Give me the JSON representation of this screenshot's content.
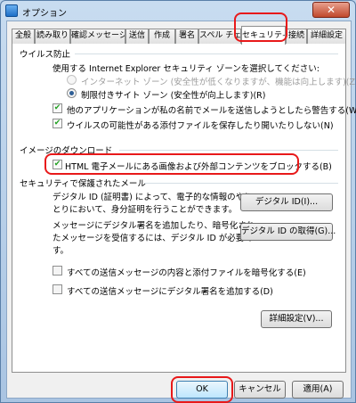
{
  "window": {
    "title": "オプション",
    "close": "✕"
  },
  "tabs": [
    {
      "label": "全般"
    },
    {
      "label": "読み取り"
    },
    {
      "label": "確認メッセージ"
    },
    {
      "label": "送信"
    },
    {
      "label": "作成"
    },
    {
      "label": "署名"
    },
    {
      "label": "スペル チェック"
    },
    {
      "label": "セキュリティ"
    },
    {
      "label": "接続"
    },
    {
      "label": "詳細設定"
    }
  ],
  "virus": {
    "group_label": "ウイルス防止",
    "zone_prompt": "使用する Internet Explorer セキュリティ ゾーンを選択してください:",
    "zone_internet": "インターネット ゾーン (安全性が低くなりますが、機能は向上します)(Z)",
    "zone_restricted": "制限付きサイト ゾーン (安全性が向上します)(R)",
    "warn_send": "他のアプリケーションが私の名前でメールを送信しようとしたら警告する(W)",
    "block_attach": "ウイルスの可能性がある添付ファイルを保存したり開いたりしない(N)"
  },
  "image": {
    "group_label": "イメージのダウンロード",
    "block_external": "HTML 電子メールにある画像および外部コンテンツをブロックする(B)"
  },
  "secure": {
    "group_label": "セキュリティで保護されたメール",
    "desc1_line1": "デジタル ID (証明書) によって、電子的な情報のやり",
    "desc1_line2": "とりにおいて、身分証明を行うことができます。",
    "desc2_line1": "メッセージにデジタル署名を追加したり、暗号化され",
    "desc2_line2": "たメッセージを受信するには、デジタル ID が必要で",
    "desc2_line3": "す。",
    "digital_id_btn": "デジタル ID(I)...",
    "get_id_btn": "デジタル ID の取得(G)...",
    "encrypt_all": "すべての送信メッセージの内容と添付ファイルを暗号化する(E)",
    "sign_all": "すべての送信メッセージにデジタル署名を追加する(D)",
    "advanced_btn": "詳細設定(V)..."
  },
  "footer": {
    "ok": "OK",
    "cancel": "キャンセル",
    "apply": "適用(A)"
  },
  "highlight_color": "#e8191a"
}
